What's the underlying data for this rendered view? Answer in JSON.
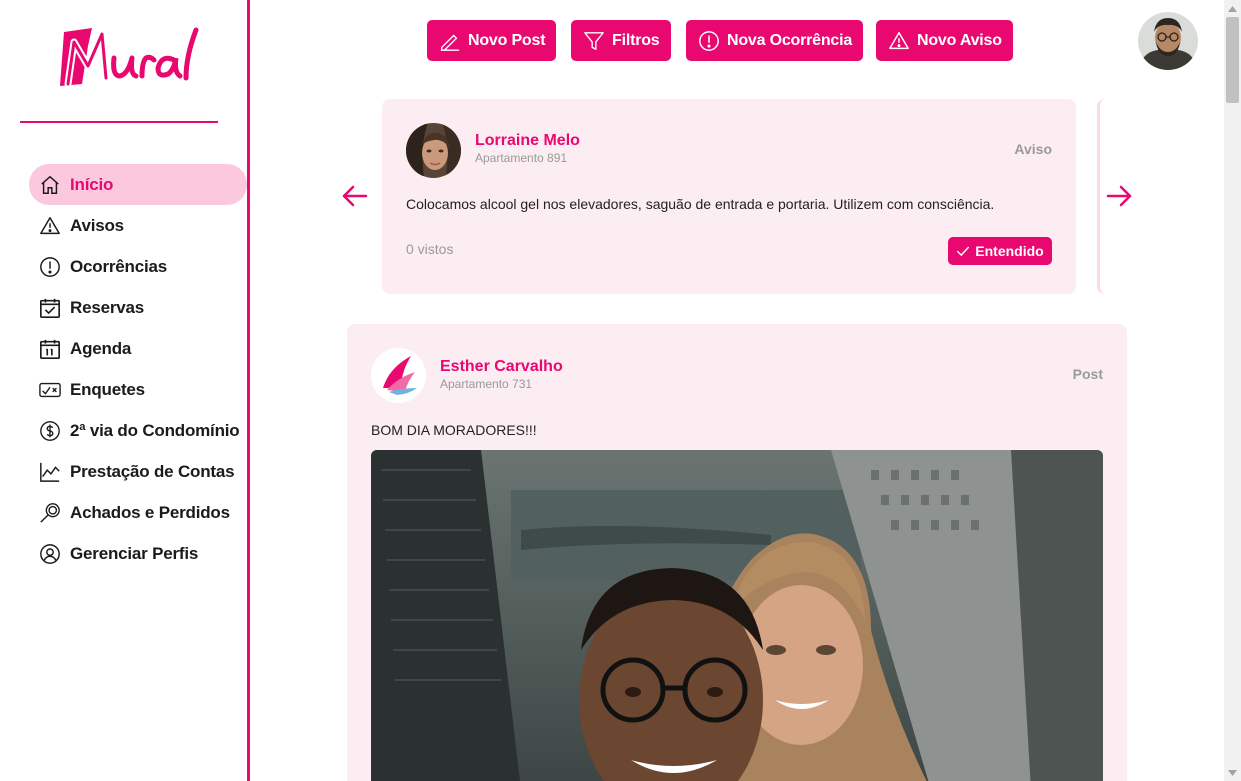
{
  "app": {
    "logo_text": "Mural",
    "brand_color": "#e8086f",
    "active_bg": "#fbc8de",
    "card_bg": "#fcedf2"
  },
  "sidebar": {
    "items": [
      {
        "label": "Início",
        "icon": "home-icon",
        "active": true
      },
      {
        "label": "Avisos",
        "icon": "warning-icon"
      },
      {
        "label": "Ocorrências",
        "icon": "alert-circle-icon"
      },
      {
        "label": "Reservas",
        "icon": "calendar-check-icon"
      },
      {
        "label": "Agenda",
        "icon": "calendar-day-icon"
      },
      {
        "label": "Enquetes",
        "icon": "poll-icon"
      },
      {
        "label": "2ª via do Condomínio",
        "icon": "dollar-circle-icon"
      },
      {
        "label": "Prestação de Contas",
        "icon": "line-chart-icon"
      },
      {
        "label": "Achados e Perdidos",
        "icon": "magnifier-icon"
      },
      {
        "label": "Gerenciar Perfis",
        "icon": "user-circle-icon"
      }
    ]
  },
  "toolbar": {
    "buttons": [
      {
        "label": "Novo Post",
        "icon": "pen-icon"
      },
      {
        "label": "Filtros",
        "icon": "filter-icon"
      },
      {
        "label": "Nova Ocorrência",
        "icon": "alert-circle-icon"
      },
      {
        "label": "Novo Aviso",
        "icon": "warning-icon"
      }
    ]
  },
  "notice": {
    "author": "Lorraine Melo",
    "apartment": "Apartamento 891",
    "type": "Aviso",
    "text": "Colocamos alcool gel nos elevadores, saguão de entrada e portaria. Utilizem com consciência.",
    "views": "0 vistos",
    "ack_label": "Entendido"
  },
  "post": {
    "author": "Esther Carvalho",
    "apartment": "Apartamento 731",
    "type": "Post",
    "text": "BOM DIA MORADORES!!!"
  }
}
